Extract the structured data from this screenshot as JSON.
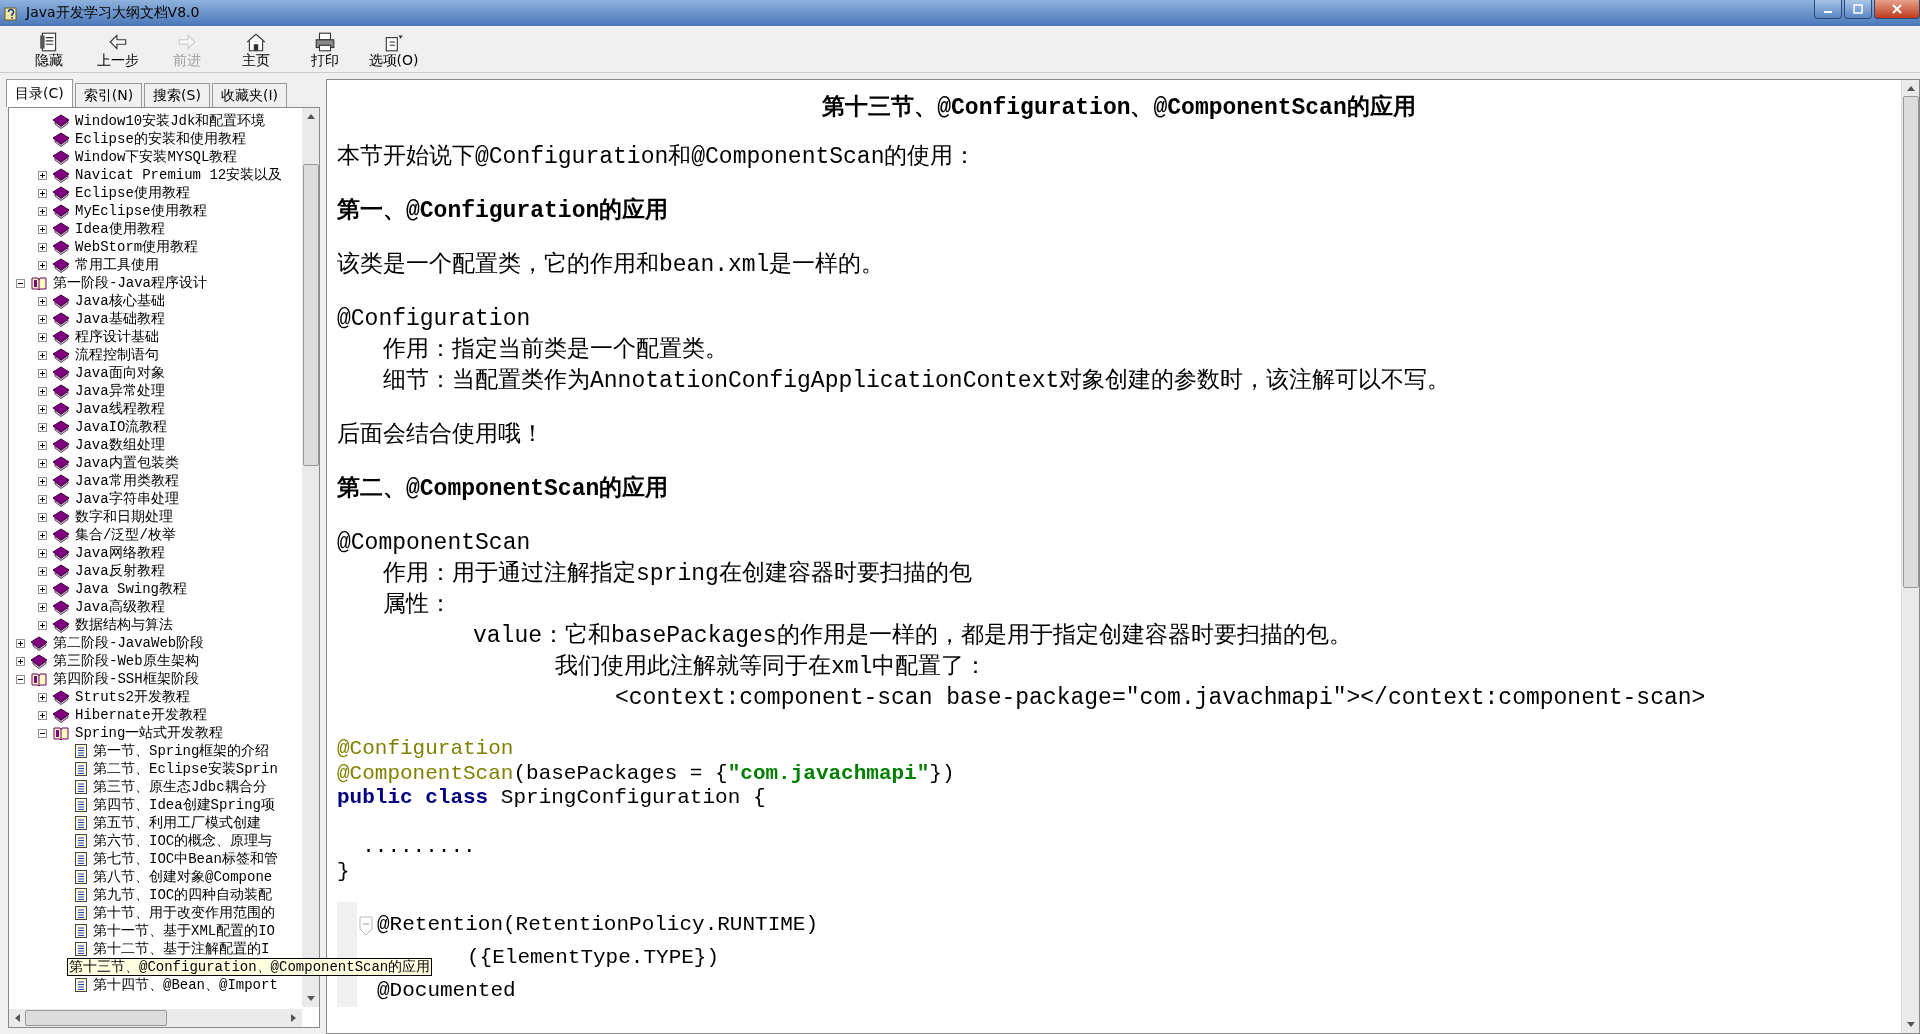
{
  "window": {
    "title": "Java开发学习大纲文档V8.0"
  },
  "toolbar": [
    {
      "kind": "hide",
      "label": "隐藏",
      "disabled": false
    },
    {
      "kind": "back",
      "label": "上一步",
      "disabled": false
    },
    {
      "kind": "forward",
      "label": "前进",
      "disabled": true
    },
    {
      "kind": "home",
      "label": "主页",
      "disabled": false
    },
    {
      "kind": "print",
      "label": "打印",
      "disabled": false
    },
    {
      "kind": "options",
      "label": "选项(O)",
      "disabled": false
    }
  ],
  "tabs": [
    {
      "label": "目录(C)",
      "selected": true
    },
    {
      "label": "索引(N)",
      "selected": false
    },
    {
      "label": "搜索(S)",
      "selected": false
    },
    {
      "label": "收藏夹(I)",
      "selected": false
    }
  ],
  "tree": {
    "continued_items": [
      {
        "label": "Window10安装Jdk和配置环境",
        "kind": "book",
        "selected": false
      },
      {
        "label": "Eclipse的安装和使用教程",
        "kind": "book",
        "selected": false
      },
      {
        "label": "Window下安装MYSQL教程",
        "kind": "book",
        "selected": false
      },
      {
        "label": "Navicat Premium 12安装以及",
        "kind": "book",
        "expanded": false,
        "selected": false
      },
      {
        "label": "Eclipse使用教程",
        "kind": "book",
        "expanded": false,
        "selected": false
      },
      {
        "label": "MyEclipse使用教程",
        "kind": "book",
        "expanded": false,
        "selected": false
      },
      {
        "label": "Idea使用教程",
        "kind": "book",
        "expanded": false,
        "selected": false
      },
      {
        "label": "WebStorm使用教程",
        "kind": "book",
        "expanded": false,
        "selected": false
      },
      {
        "label": "常用工具使用",
        "kind": "book",
        "expanded": false,
        "selected": false
      }
    ],
    "items": [
      {
        "label": "第一阶段-Java程序设计",
        "kind": "book",
        "expanded": true,
        "selected": false,
        "children": [
          {
            "label": "Java核心基础",
            "kind": "book",
            "expanded": false,
            "selected": false
          },
          {
            "label": "Java基础教程",
            "kind": "book",
            "expanded": false,
            "selected": false
          },
          {
            "label": "程序设计基础",
            "kind": "book",
            "expanded": false,
            "selected": false
          },
          {
            "label": "流程控制语句",
            "kind": "book",
            "expanded": false,
            "selected": false
          },
          {
            "label": "Java面向对象",
            "kind": "book",
            "expanded": false,
            "selected": false
          },
          {
            "label": "Java异常处理",
            "kind": "book",
            "expanded": false,
            "selected": false
          },
          {
            "label": "Java线程教程",
            "kind": "book",
            "expanded": false,
            "selected": false
          },
          {
            "label": "JavaIO流教程",
            "kind": "book",
            "expanded": false,
            "selected": false
          },
          {
            "label": "Java数组处理",
            "kind": "book",
            "expanded": false,
            "selected": false
          },
          {
            "label": "Java内置包装类",
            "kind": "book",
            "expanded": false,
            "selected": false
          },
          {
            "label": "Java常用类教程",
            "kind": "book",
            "expanded": false,
            "selected": false
          },
          {
            "label": "Java字符串处理",
            "kind": "book",
            "expanded": false,
            "selected": false
          },
          {
            "label": "数字和日期处理",
            "kind": "book",
            "expanded": false,
            "selected": false
          },
          {
            "label": "集合/泛型/枚举",
            "kind": "book",
            "expanded": false,
            "selected": false
          },
          {
            "label": "Java网络教程",
            "kind": "book",
            "expanded": false,
            "selected": false
          },
          {
            "label": "Java反射教程",
            "kind": "book",
            "expanded": false,
            "selected": false
          },
          {
            "label": "Java Swing教程",
            "kind": "book",
            "expanded": false,
            "selected": false
          },
          {
            "label": "Java高级教程",
            "kind": "book",
            "expanded": false,
            "selected": false
          },
          {
            "label": "数据结构与算法",
            "kind": "book",
            "expanded": false,
            "selected": false
          }
        ]
      },
      {
        "label": "第二阶段-JavaWeb阶段",
        "kind": "book",
        "expanded": false,
        "selected": false
      },
      {
        "label": "第三阶段-Web原生架构",
        "kind": "book",
        "expanded": false,
        "selected": false
      },
      {
        "label": "第四阶段-SSH框架阶段",
        "kind": "book",
        "expanded": true,
        "selected": false,
        "children": [
          {
            "label": "Struts2开发教程",
            "kind": "book",
            "expanded": false,
            "selected": false
          },
          {
            "label": "Hibernate开发教程",
            "kind": "book",
            "expanded": false,
            "selected": false
          },
          {
            "label": "Spring一站式开发教程",
            "kind": "book",
            "expanded": true,
            "selected": false,
            "children": [
              {
                "label": "第一节、Spring框架的介绍",
                "kind": "page",
                "selected": false
              },
              {
                "label": "第二节、Eclipse安装Sprin",
                "kind": "page",
                "selected": false
              },
              {
                "label": "第三节、原生态Jdbc耦合分",
                "kind": "page",
                "selected": false
              },
              {
                "label": "第四节、Idea创建Spring项",
                "kind": "page",
                "selected": false
              },
              {
                "label": "第五节、利用工厂模式创建",
                "kind": "page",
                "selected": false
              },
              {
                "label": "第六节、IOC的概念、原理与",
                "kind": "page",
                "selected": false
              },
              {
                "label": "第七节、IOC中Bean标签和管",
                "kind": "page",
                "selected": false
              },
              {
                "label": "第八节、创建对象@Compone",
                "kind": "page",
                "selected": false
              },
              {
                "label": "第九节、IOC的四种自动装配",
                "kind": "page",
                "selected": false
              },
              {
                "label": "第十节、用于改变作用范围的",
                "kind": "page",
                "selected": false
              },
              {
                "label": "第十一节、基于XML配置的IO",
                "kind": "page",
                "selected": false
              },
              {
                "label": "第十二节、基于注解配置的I",
                "kind": "page",
                "selected": false
              },
              {
                "label": "第十三节、@Configuration、@ComponentScan的应用",
                "kind": "page",
                "selected": true
              },
              {
                "label": "第十四节、@Bean、@Import",
                "kind": "page",
                "selected": false
              }
            ]
          }
        ]
      }
    ]
  },
  "article": {
    "title": "第十三节、@Configuration、@ComponentScan的应用",
    "blocks": [
      {
        "kind": "para",
        "text": "本节开始说下@Configuration和@ComponentScan的使用："
      },
      {
        "kind": "heading",
        "text": "第一、@Configuration的应用"
      },
      {
        "kind": "para",
        "text": "该类是一个配置类，它的作用和bean.xml是一样的。"
      },
      {
        "kind": "para",
        "text": "@Configuration",
        "children": [
          {
            "text": "作用：指定当前类是一个配置类。"
          },
          {
            "text": "细节：当配置类作为AnnotationConfigApplicationContext对象创建的参数时，该注解可以不写。"
          }
        ]
      },
      {
        "kind": "para",
        "text": "后面会结合使用哦！"
      },
      {
        "kind": "heading",
        "text": "第二、@ComponentScan的应用"
      },
      {
        "kind": "para",
        "text": "@ComponentScan",
        "children": [
          {
            "text": "作用：用于通过注解指定spring在创建容器时要扫描的包"
          },
          {
            "text": "属性：",
            "children": [
              {
                "text": "value：它和basePackages的作用是一样的，都是用于指定创建容器时要扫描的包。",
                "children": [
                  {
                    "text": "我们使用此注解就等同于在xml中配置了：",
                    "children": [
                      {
                        "text": "<context:component-scan base-package=\"com.javachmapi\"></context:component-scan>"
                      }
                    ]
                  }
                ]
              }
            ]
          }
        ]
      }
    ],
    "code": [
      {
        "tokens": [
          {
            "kind": "annotation",
            "text": "@Configuration"
          }
        ]
      },
      {
        "tokens": [
          {
            "kind": "annotation",
            "text": "@ComponentScan"
          },
          {
            "kind": "plain",
            "text": "(basePackages = {"
          },
          {
            "kind": "string",
            "text": "\"com.javachmapi\""
          },
          {
            "kind": "plain",
            "text": "})"
          }
        ]
      },
      {
        "tokens": [
          {
            "kind": "keyword",
            "text": "public class"
          },
          {
            "kind": "plain",
            "text": " SpringConfiguration {"
          }
        ]
      },
      {
        "tokens": [
          {
            "kind": "plain",
            "text": "  ........."
          }
        ]
      },
      {
        "tokens": [
          {
            "kind": "plain",
            "text": "}"
          }
        ]
      }
    ],
    "snippet": [
      {
        "text": "@Retention(RetentionPolicy.RUNTIME)",
        "fold": true,
        "covered": false
      },
      {
        "text": "({ElementType.TYPE})",
        "fold": false,
        "covered": true
      },
      {
        "text": "@Documented",
        "fold": false,
        "covered": false
      }
    ]
  }
}
